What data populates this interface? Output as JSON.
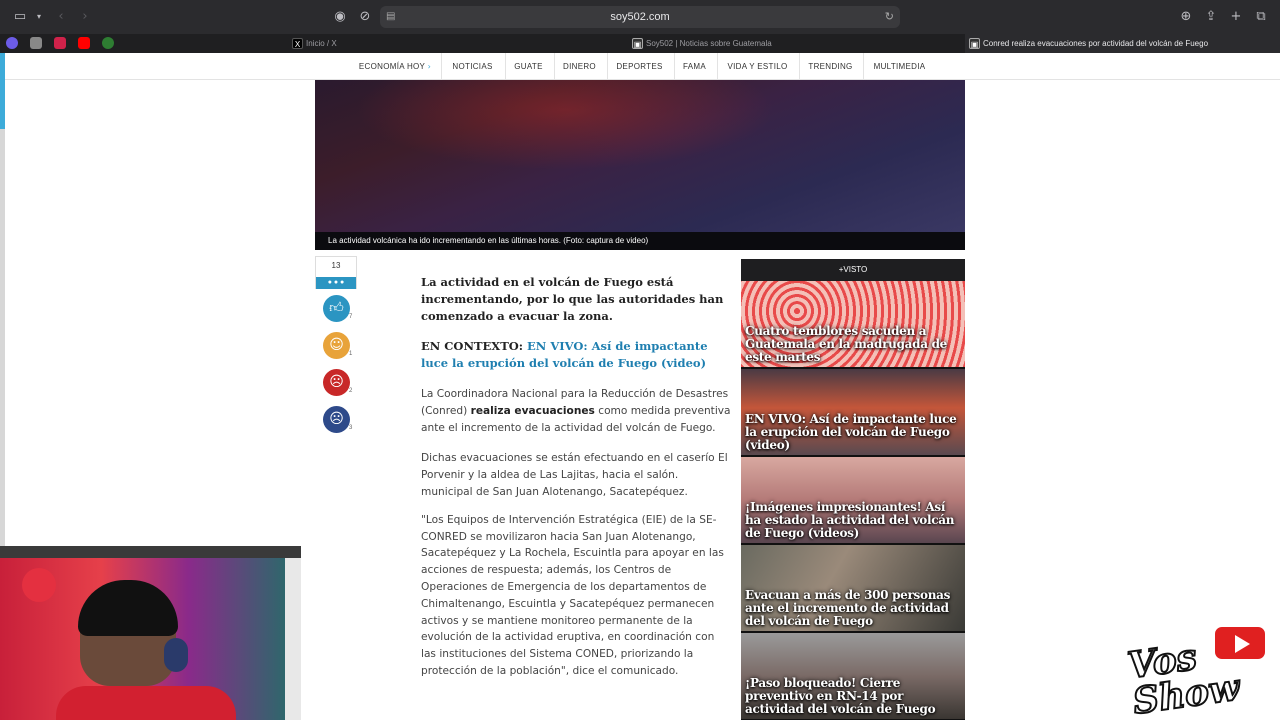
{
  "browser": {
    "url": "soy502.com",
    "tabs": [
      {
        "label": "Inicio / X",
        "icon": "x-logo-icon",
        "active": false
      },
      {
        "label": "Soy502 | Noticias sobre Guatemala",
        "icon": "soy502-icon",
        "active": false
      },
      {
        "label": "Conred realiza evacuaciones por actividad del volcán de Fuego",
        "icon": "soy502-icon",
        "active": true
      }
    ]
  },
  "nav": {
    "items": [
      "ECONOMÍA HOY",
      "NOTICIAS",
      "GUATE",
      "DINERO",
      "DEPORTES",
      "FAMA",
      "VIDA Y ESTILO",
      "TRENDING",
      "MULTIMEDIA"
    ]
  },
  "hero": {
    "caption": "La actividad volcánica ha ido incrementando en las últimas horas. (Foto: captura de video)"
  },
  "reactions": {
    "total": "13",
    "items": [
      {
        "name": "like",
        "count": "7",
        "color": "#2b95c2"
      },
      {
        "name": "laugh",
        "count": "1",
        "color": "#e8a33a"
      },
      {
        "name": "angry",
        "count": "2",
        "color": "#c82828"
      },
      {
        "name": "sad",
        "count": "3",
        "color": "#2e4a8a"
      }
    ]
  },
  "article": {
    "lead": "La actividad en el volcán de Fuego está incrementando, por lo que las autoridades han comenzado a evacuar la zona.",
    "context_prefix": "EN CONTEXTO:",
    "context_link": "EN VIVO: Así de impactante luce la erupción del volcán de Fuego (video)",
    "p1_before": "La Coordinadora Nacional para la Reducción de Desastres (Conred)",
    "p1_bold": "realiza evacuaciones",
    "p1_after": "como medida preventiva ante el incremento de la actividad del volcán de Fuego.",
    "p2": "Dichas evacuaciones se están efectuando en el caserío El Porvenir y la aldea de Las Lajitas, hacia el salón. municipal de San Juan Alotenango, Sacatepéquez.",
    "p3": "\"Los Equipos de Intervención Estratégica (EIE) de la SE-CONRED se movilizaron hacia San Juan Alotenango, Sacatepéquez y La Rochela, Escuintla para apoyar en las acciones de respuesta; además, los Centros de Operaciones de Emergencia de los departamentos de Chimaltenango, Escuintla y Sacatepéquez permanecen activos y se mantiene monitoreo permanente de la evolución de la actividad eruptiva, en coordinación con las instituciones del Sistema CONED, priorizando la protección de la población\", dice el comunicado."
  },
  "sidebar": {
    "heading": "+VISTO",
    "cards": [
      {
        "title": "Cuatro temblores sacuden a Guatemala en la madrugada de este martes"
      },
      {
        "title": "EN VIVO: Así de impactante luce la erupción del volcán de Fuego (video)"
      },
      {
        "title": "¡Imágenes impresionantes! Así ha estado la actividad del volcán de Fuego (videos)"
      },
      {
        "title": "Evacuan a más de 300 personas ante el incremento de actividad del volcán de Fuego"
      },
      {
        "title": "¡Paso bloqueado! Cierre preventivo en RN-14 por actividad del volcán de Fuego"
      }
    ]
  },
  "overlay": {
    "watermark_text": "Vos Show"
  }
}
